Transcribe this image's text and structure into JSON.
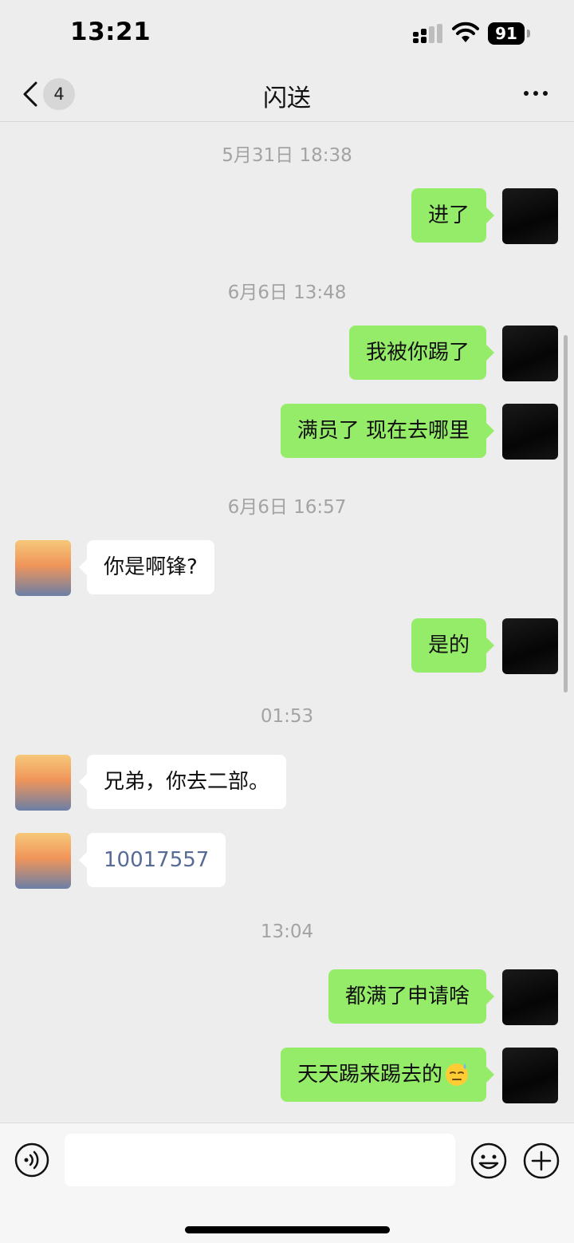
{
  "status_bar": {
    "time": "13:21",
    "battery": "91",
    "icons": [
      "signal-icon",
      "wifi-icon",
      "battery-icon"
    ]
  },
  "nav": {
    "back_icon": "chevron-left-icon",
    "unread_count": "4",
    "title": "闪送",
    "more_icon": "more-horizontal-icon"
  },
  "messages": [
    {
      "type": "timestamp",
      "text": "5月31日 18:38"
    },
    {
      "type": "message",
      "from": "me",
      "text": "进了"
    },
    {
      "type": "timestamp",
      "text": "6月6日 13:48"
    },
    {
      "type": "message",
      "from": "me",
      "text": "我被你踢了"
    },
    {
      "type": "message",
      "from": "me",
      "text": "满员了 现在去哪里"
    },
    {
      "type": "timestamp",
      "text": "6月6日 16:57"
    },
    {
      "type": "message",
      "from": "other",
      "text": "你是啊锋?"
    },
    {
      "type": "message",
      "from": "me",
      "text": "是的"
    },
    {
      "type": "timestamp",
      "text": "01:53"
    },
    {
      "type": "message",
      "from": "other",
      "text": "兄弟，你去二部。"
    },
    {
      "type": "message",
      "from": "other",
      "text": "10017557",
      "link": true
    },
    {
      "type": "timestamp",
      "text": "13:04"
    },
    {
      "type": "message",
      "from": "me",
      "text": "都满了申请啥"
    },
    {
      "type": "message",
      "from": "me",
      "text": "天天踢来踢去的",
      "emoji": "downcast-sweat-emoji"
    }
  ],
  "input_bar": {
    "voice_icon": "voice-icon",
    "input_value": "",
    "emoji_icon": "smiley-icon",
    "plus_icon": "plus-circle-icon"
  },
  "colors": {
    "background": "#ededed",
    "my_bubble": "#95ec69",
    "their_bubble": "#ffffff",
    "link": "#576b95",
    "timestamp": "#a3a3a3"
  }
}
